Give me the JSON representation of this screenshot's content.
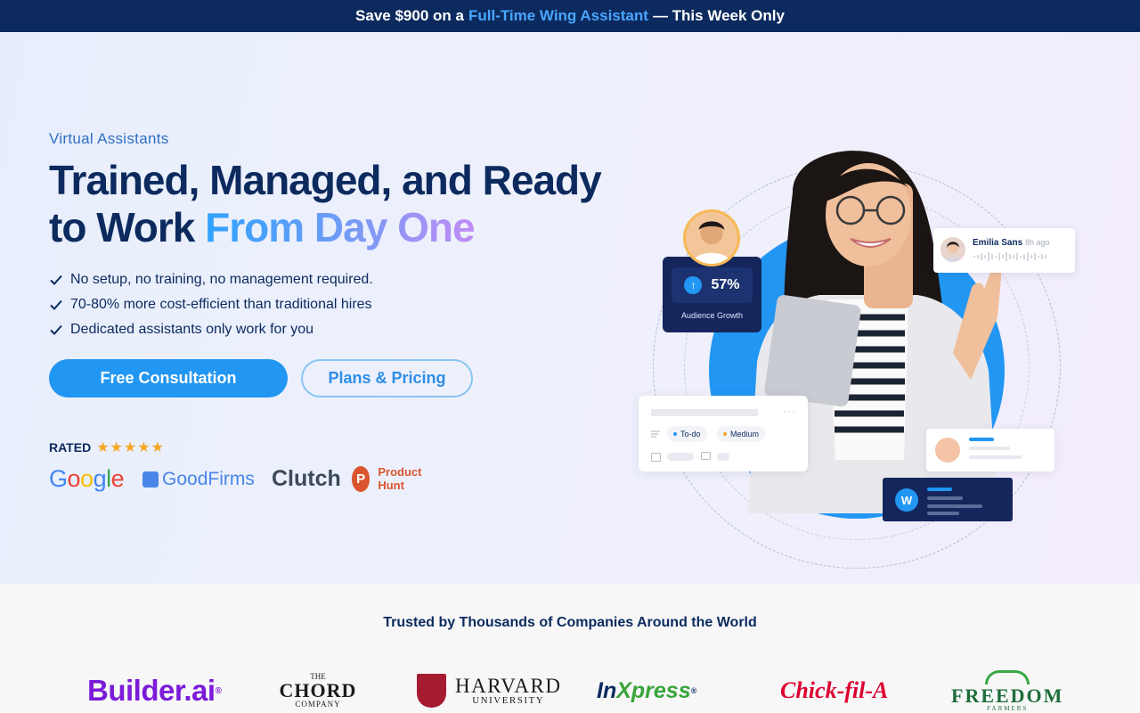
{
  "promo": {
    "prefix": "Save $900 on a",
    "highlight": "Full-Time Wing Assistant",
    "suffix": "— This Week Only"
  },
  "hero": {
    "eyebrow": "Virtual Assistants",
    "headline_line1": "Trained, Managed, and Ready",
    "headline_line2_plain": "to Work",
    "headline_line2_gradient": "From Day One",
    "bullets": [
      "No setup, no training, no management required.",
      "70-80% more cost-efficient than traditional hires",
      "Dedicated assistants only work for you"
    ],
    "primary_cta": "Free Consultation",
    "secondary_cta": "Plans & Pricing",
    "rated_label": "RATED",
    "rating_stars": "★★★★★",
    "review_logos": {
      "google": [
        "G",
        "o",
        "o",
        "g",
        "l",
        "e"
      ],
      "goodfirms": "GoodFirms",
      "clutch": "Clutch",
      "producthunt_mark": "P",
      "producthunt": "Product Hunt"
    }
  },
  "visual": {
    "stat_value": "57%",
    "stat_label": "Audience Growth",
    "stat_icon": "arrow-up-icon",
    "message_name": "Emilia Sans",
    "message_time": "8h ago",
    "task_chip_todo": "To-do",
    "task_chip_priority": "Medium",
    "task_menu": "···",
    "brand_mark": "W"
  },
  "trusted": {
    "title": "Trusted by Thousands of Companies Around the World",
    "companies": {
      "builder": "Builder.ai",
      "builder_mark": "®",
      "chord_top": "THE",
      "chord_main": "CHORD",
      "chord_bottom": "COMPANY",
      "harvard_main": "HARVARD",
      "harvard_sub": "UNIVERSITY",
      "inxpress_a": "In",
      "inxpress_b": "Xpress",
      "inxpress_mark": "®",
      "chick": "Chick-fil-A",
      "freedom_main": "FREEDOM",
      "freedom_sub": "FARMERS"
    }
  },
  "colors": {
    "navy": "#0c2a5e",
    "accent_blue": "#2196f3",
    "star_gold": "#f5a623"
  }
}
